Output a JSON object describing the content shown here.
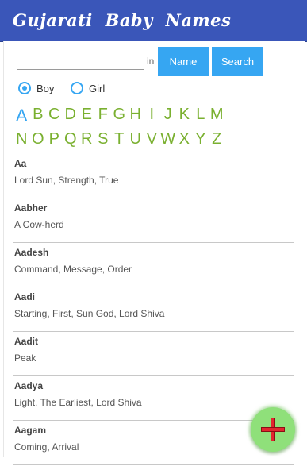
{
  "app": {
    "title": "Gujarati  Baby  Names"
  },
  "search": {
    "value": "",
    "placeholder": "",
    "in_label": "in",
    "name_button": "Name",
    "search_button": "Search"
  },
  "gender": {
    "boy": "Boy",
    "girl": "Girl",
    "selected": "Boy"
  },
  "alphabet": {
    "row1": [
      "A",
      "B",
      "C",
      "D",
      "E",
      "F",
      "G",
      "H",
      "I",
      "J",
      "K",
      "L",
      "M"
    ],
    "row2": [
      "N",
      "O",
      "P",
      "Q",
      "R",
      "S",
      "T",
      "U",
      "V",
      "W",
      "X",
      "Y",
      "Z"
    ],
    "active": "A"
  },
  "names": [
    {
      "name": "Aa",
      "meaning": "Lord Sun, Strength, True"
    },
    {
      "name": "Aabher",
      "meaning": "A Cow-herd"
    },
    {
      "name": "Aadesh",
      "meaning": "Command, Message, Order"
    },
    {
      "name": "Aadi",
      "meaning": "Starting, First, Sun God, Lord Shiva"
    },
    {
      "name": "Aadit",
      "meaning": "Peak"
    },
    {
      "name": "Aadya",
      "meaning": "Light, The Earliest, Lord Shiva"
    },
    {
      "name": "Aagam",
      "meaning": "Coming, Arrival"
    }
  ],
  "fab": {
    "icon": "add-icon"
  },
  "colors": {
    "appbar": "#3a56b9",
    "button": "#36a6f2",
    "letters": "#7ab030",
    "fab": "#8fe07a",
    "plus": "#e2262f"
  }
}
